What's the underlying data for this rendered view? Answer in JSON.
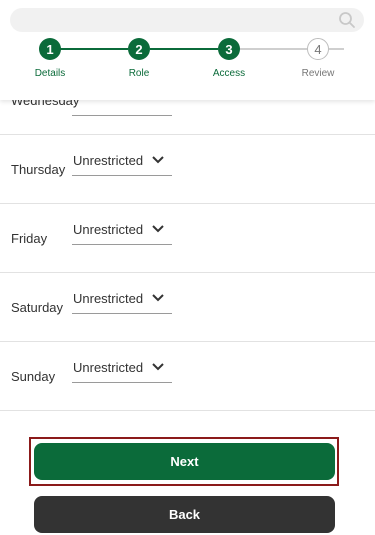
{
  "search": {
    "icon": "search-icon",
    "placeholder": ""
  },
  "stepper": {
    "steps": [
      {
        "number": "1",
        "label": "Details",
        "state": "complete"
      },
      {
        "number": "2",
        "label": "Role",
        "state": "complete"
      },
      {
        "number": "3",
        "label": "Access",
        "state": "current"
      },
      {
        "number": "4",
        "label": "Review",
        "state": "upcoming"
      }
    ]
  },
  "schedule": {
    "rows": [
      {
        "day": "Wednesday",
        "value": ""
      },
      {
        "day": "Thursday",
        "value": "Unrestricted"
      },
      {
        "day": "Friday",
        "value": "Unrestricted"
      },
      {
        "day": "Saturday",
        "value": "Unrestricted"
      },
      {
        "day": "Sunday",
        "value": "Unrestricted"
      }
    ]
  },
  "buttons": {
    "next_label": "Next",
    "back_label": "Back"
  },
  "colors": {
    "primary": "#0b6b3a",
    "secondary": "#333333",
    "focus": "#8b1a1a"
  }
}
